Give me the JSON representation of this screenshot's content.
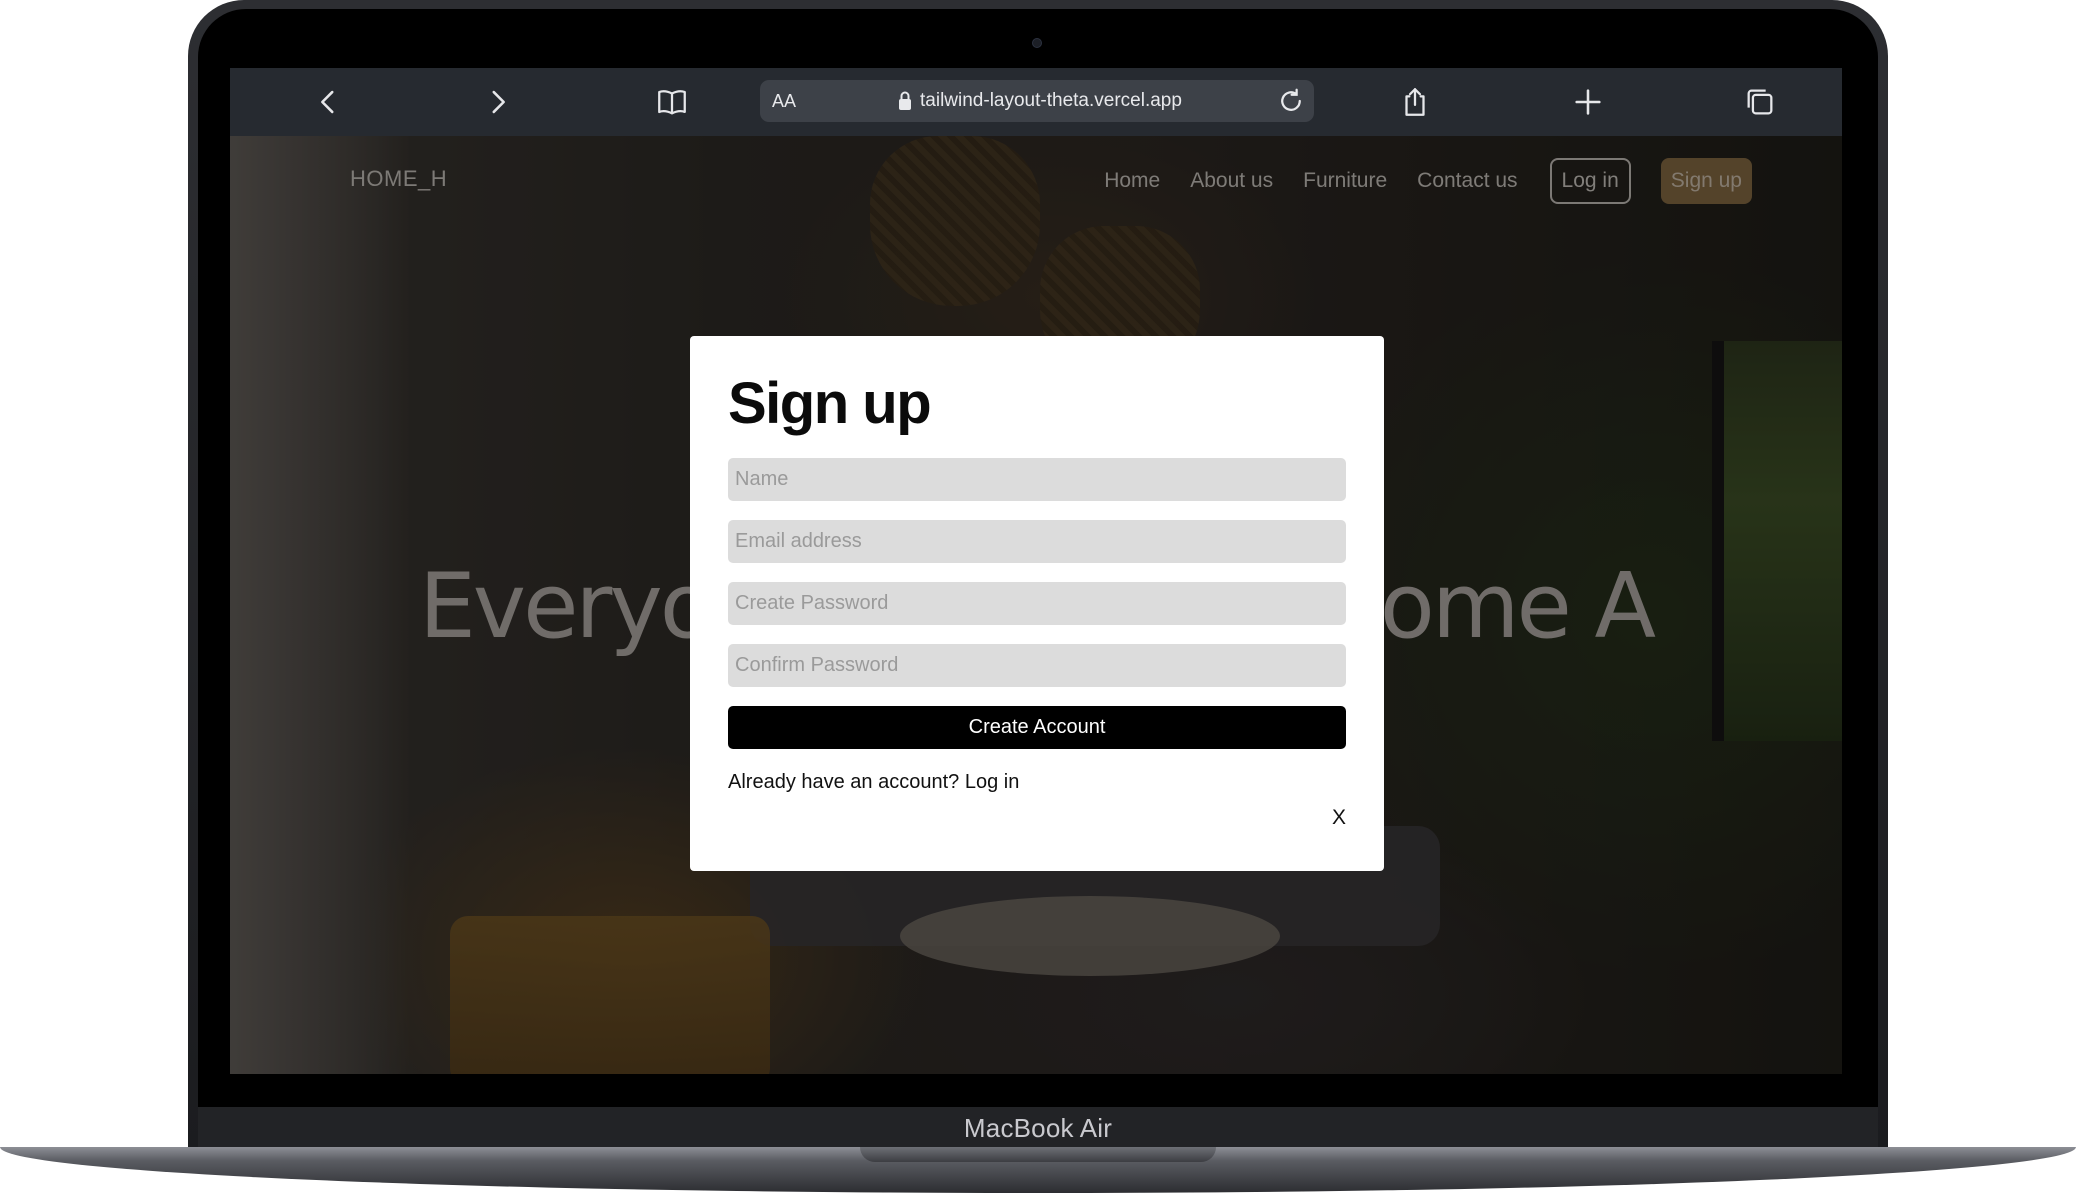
{
  "device": {
    "label": "MacBook Air"
  },
  "browser": {
    "aa_label": "AA",
    "url": "tailwind-layout-theta.vercel.app"
  },
  "site": {
    "logo": "HOME_H",
    "nav": [
      "Home",
      "About us",
      "Furniture",
      "Contact us"
    ],
    "login_label": "Log in",
    "signup_label": "Sign up",
    "hero_visible_left": "Everyo",
    "hero_visible_right": "ome A"
  },
  "modal": {
    "title": "Sign up",
    "fields": {
      "name_placeholder": "Name",
      "email_placeholder": "Email address",
      "password_placeholder": "Create Password",
      "confirm_placeholder": "Confirm Password"
    },
    "submit_label": "Create Account",
    "already_text": "Already have an account? Log in",
    "close_label": "X"
  },
  "colors": {
    "signup_button": "#8a6f44",
    "submit_button": "#000000",
    "field_background": "#dcdcdc"
  }
}
